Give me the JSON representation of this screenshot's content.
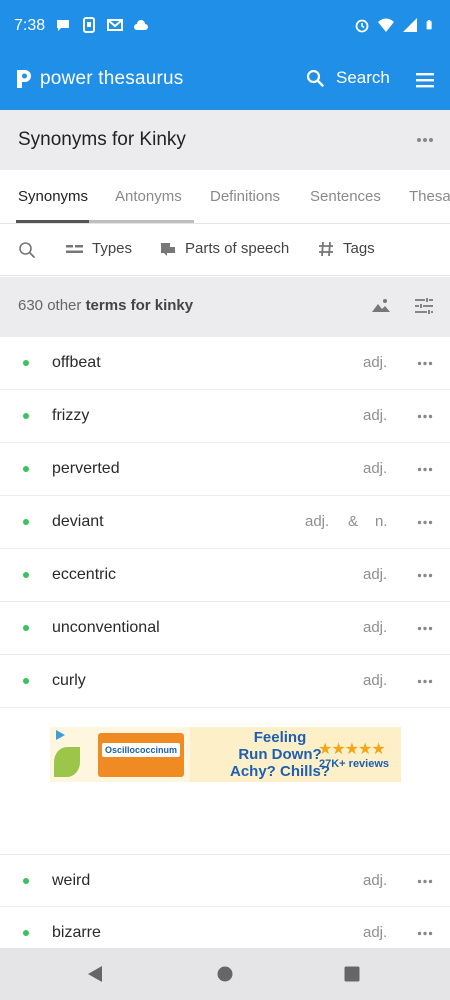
{
  "status_bar": {
    "time": "7:38",
    "left_icons": [
      "chat-bubble-icon",
      "sim-phone-icon",
      "gmail-icon",
      "cloud-icon"
    ],
    "right_icons": [
      "alarm-icon",
      "wifi-icon",
      "signal-icon",
      "battery-icon"
    ]
  },
  "app_bar": {
    "brand": "power thesaurus",
    "search_label": "Search",
    "color": "#1f8fe8"
  },
  "title": {
    "text": "Synonyms for Kinky"
  },
  "tabs": [
    {
      "label": "Synonyms",
      "active": true
    },
    {
      "label": "Antonyms",
      "active": false
    },
    {
      "label": "Definitions",
      "active": false
    },
    {
      "label": "Sentences",
      "active": false
    },
    {
      "label": "Thesa",
      "active": false
    }
  ],
  "filters": {
    "types": "Types",
    "parts_of_speech": "Parts of speech",
    "tags": "Tags"
  },
  "summary": {
    "prefix": "630 other ",
    "bold": "terms for kinky"
  },
  "rows_top": [
    {
      "word": "offbeat",
      "pos": "adj."
    },
    {
      "word": "frizzy",
      "pos": "adj."
    },
    {
      "word": "perverted",
      "pos": "adj."
    },
    {
      "word": "deviant",
      "pos": "adj.",
      "amp": "&",
      "pos2": "n."
    },
    {
      "word": "eccentric",
      "pos": "adj."
    },
    {
      "word": "unconventional",
      "pos": "adj."
    },
    {
      "word": "curly",
      "pos": "adj."
    }
  ],
  "ad": {
    "brand": "Oscillococcinum",
    "headline_1": "Feeling",
    "headline_2": "Run Down?",
    "headline_3": "Achy? Chills?",
    "stars": "★★★★★",
    "reviews": "27K+ reviews"
  },
  "rows_bottom": [
    {
      "word": "weird",
      "pos": "adj."
    },
    {
      "word": "bizarre",
      "pos": "adj."
    }
  ],
  "accent_dot_color": "#3cc25c"
}
